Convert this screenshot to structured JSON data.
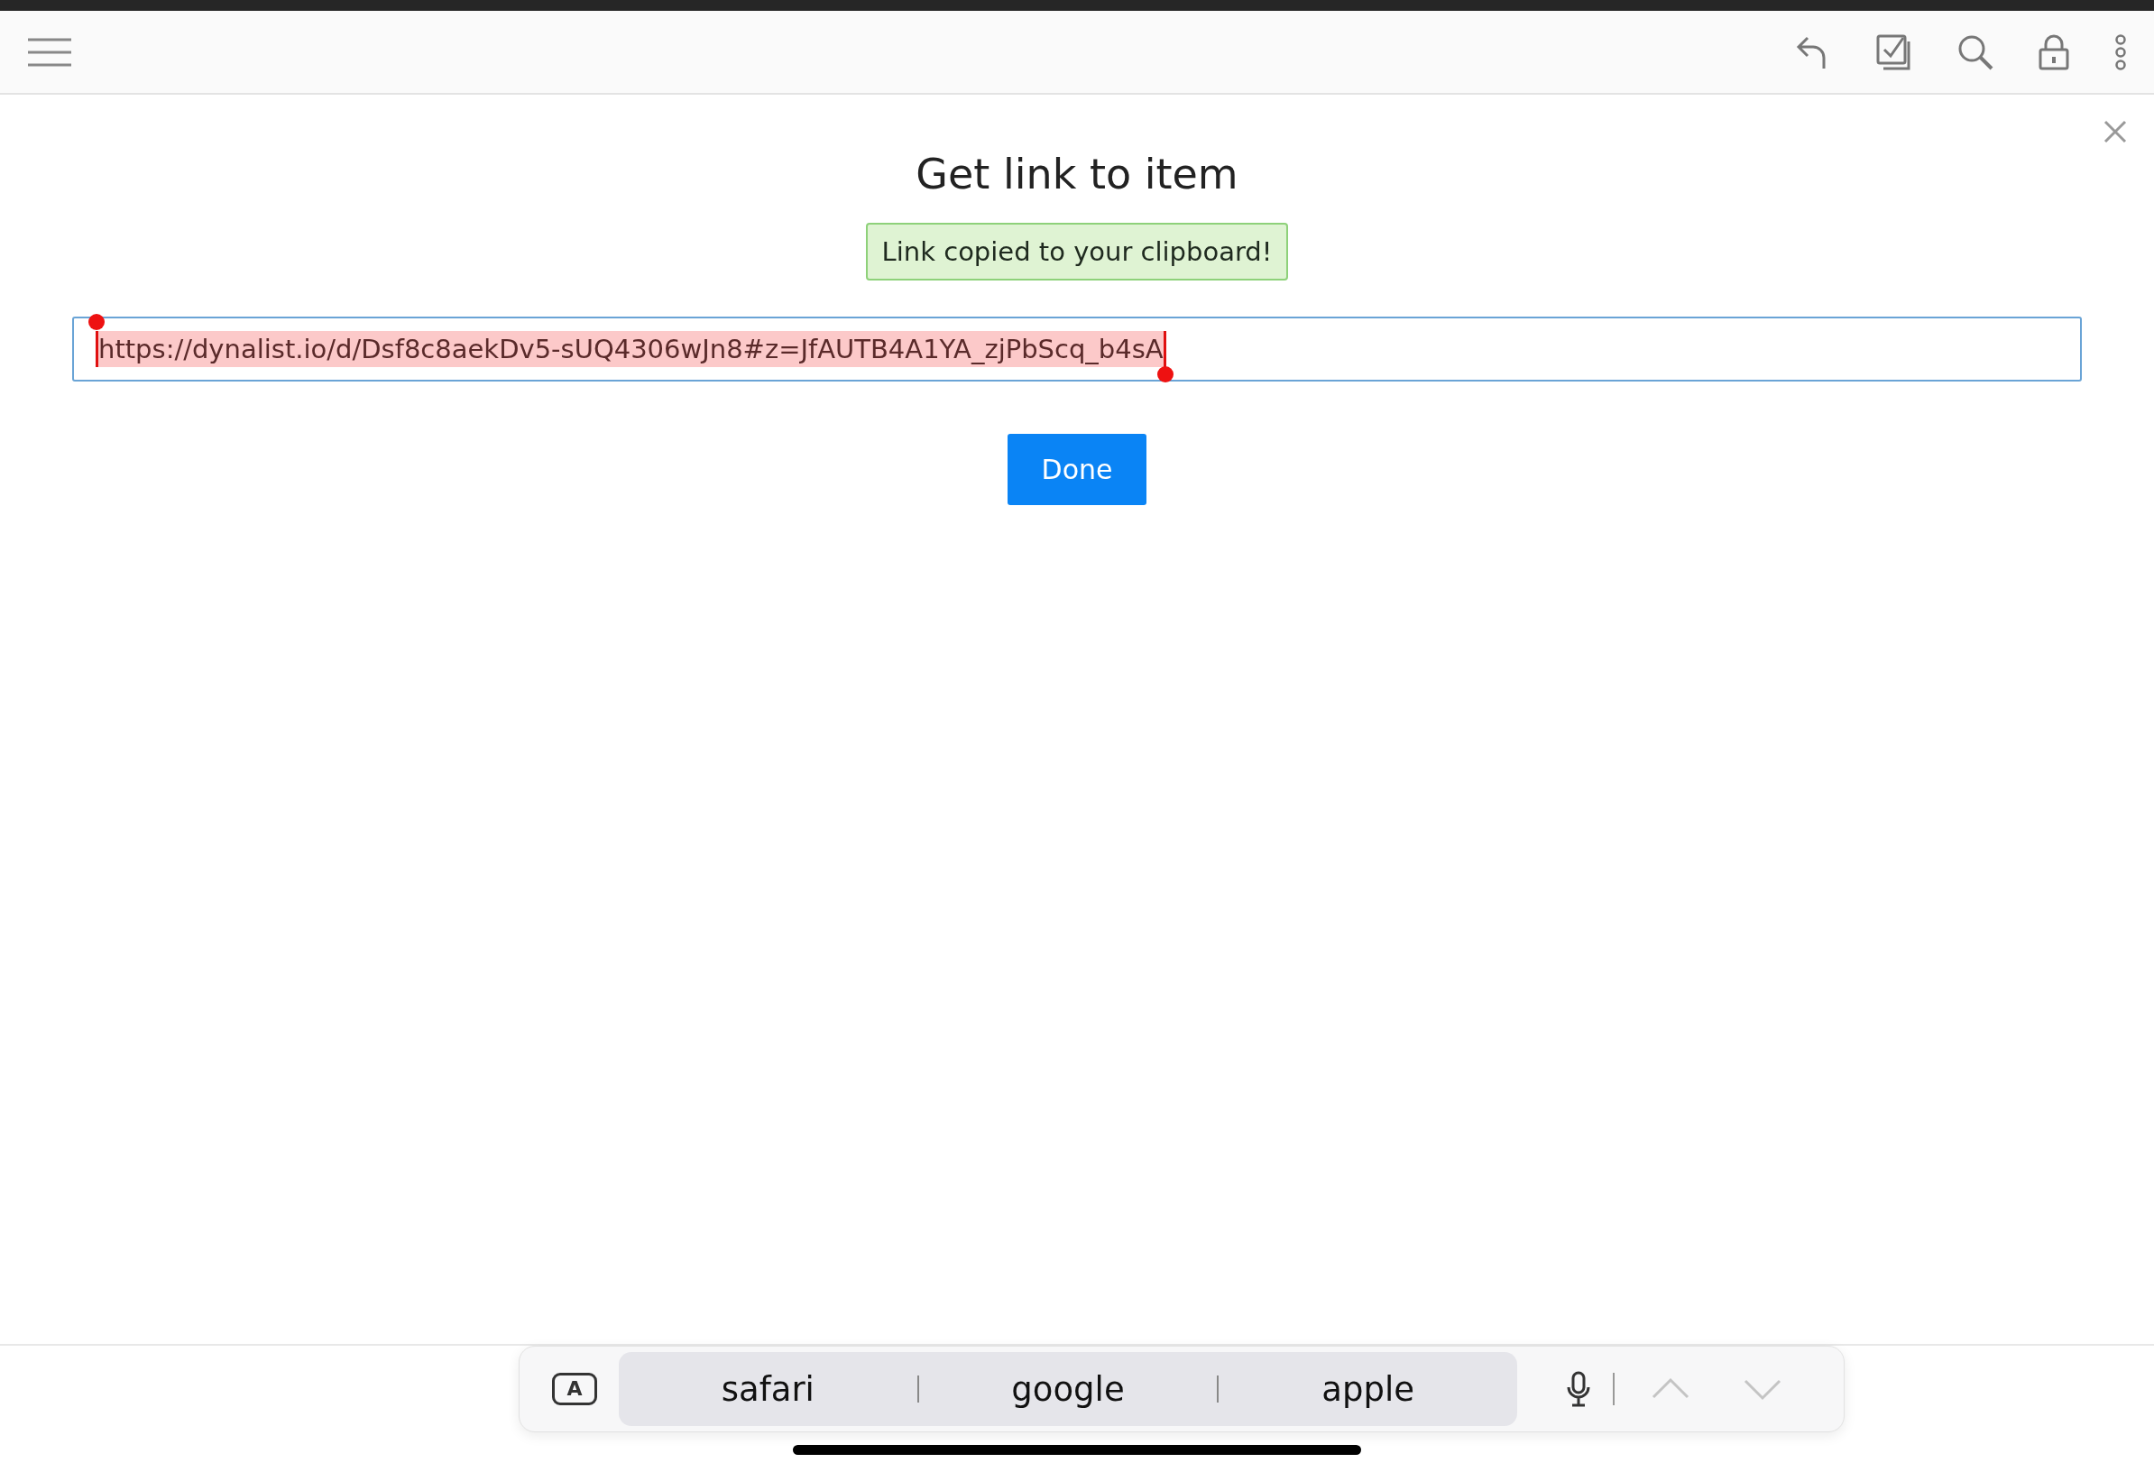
{
  "toolbar": {
    "tools": [
      {
        "kind": "undo"
      },
      {
        "kind": "checklist"
      },
      {
        "kind": "search"
      },
      {
        "kind": "lock"
      },
      {
        "kind": "more"
      }
    ]
  },
  "dialog": {
    "title": "Get link to item",
    "notice": "Link copied to your clipboard!",
    "link_field": {
      "value": "https://dynalist.io/d/Dsf8c8aekDv5-sUQ4306wJn8#z=JfAUTB4A1YA_zjPbScq_b4sA",
      "text_selected": true
    },
    "done_button": "Done"
  },
  "keyboard_bar": {
    "keyboard_key": "A",
    "suggestions": [
      "safari",
      "google",
      "apple"
    ],
    "nav": [
      {
        "kind": "up",
        "disabled": true
      },
      {
        "kind": "down",
        "disabled": true
      }
    ]
  }
}
